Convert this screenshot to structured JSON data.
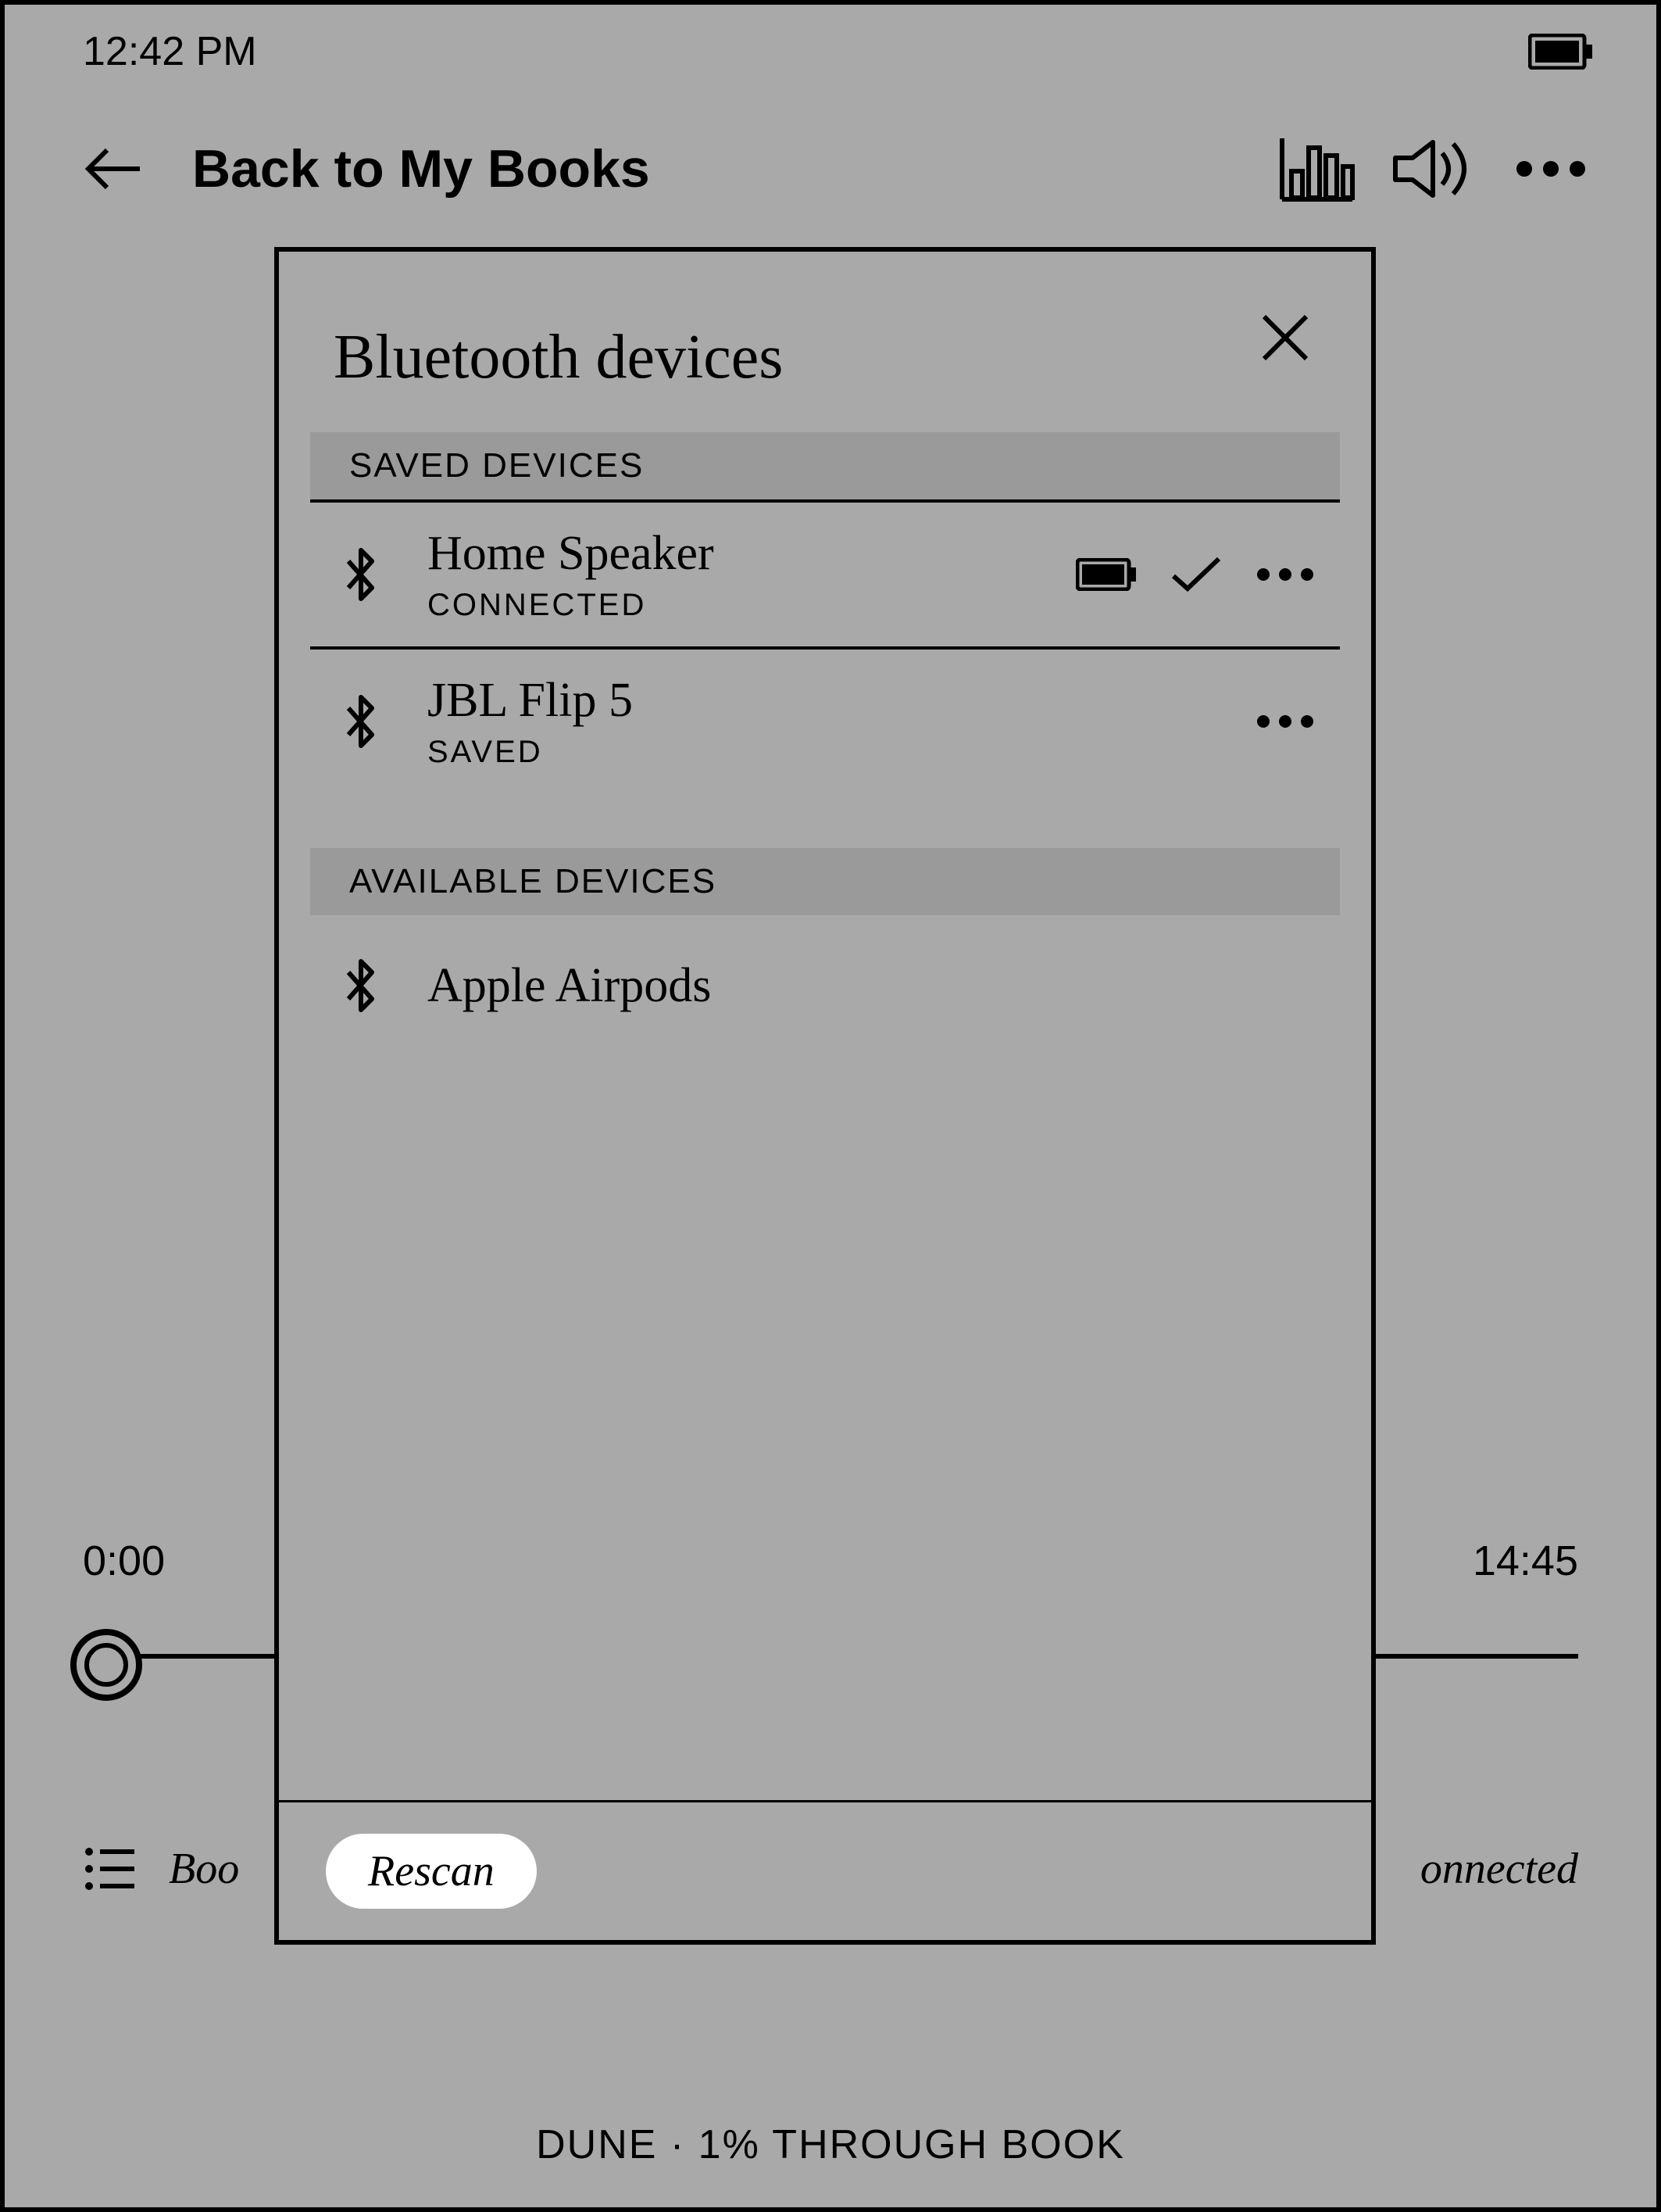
{
  "statusbar": {
    "time": "12:42 PM"
  },
  "header": {
    "back_label": "Back to My Books"
  },
  "playback": {
    "time_start": "0:00",
    "time_end": "14:45"
  },
  "bottom": {
    "left_fragment": "Boo",
    "right_fragment": "onnected"
  },
  "footer": {
    "progress": "DUNE · 1% THROUGH BOOK"
  },
  "modal": {
    "title": "Bluetooth devices",
    "rescan_label": "Rescan",
    "sections": {
      "saved_header": "SAVED DEVICES",
      "available_header": "AVAILABLE DEVICES"
    },
    "saved_devices": [
      {
        "name": "Home Speaker",
        "status": "CONNECTED",
        "show_battery": true,
        "show_check": true
      },
      {
        "name": "JBL Flip 5",
        "status": "SAVED",
        "show_battery": false,
        "show_check": false
      }
    ],
    "available_devices": [
      {
        "name": "Apple Airpods"
      }
    ]
  }
}
